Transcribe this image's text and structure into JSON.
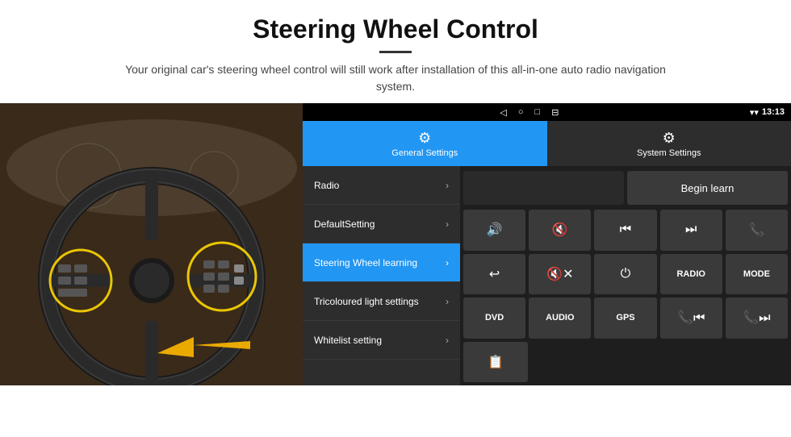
{
  "header": {
    "title": "Steering Wheel Control",
    "subtitle": "Your original car's steering wheel control will still work after installation of this all-in-one auto radio navigation system."
  },
  "statusBar": {
    "time": "13:13",
    "backIcon": "◁",
    "homeIcon": "○",
    "squareIcon": "□",
    "menuIcon": "⊟",
    "wifiIcon": "▾",
    "signalIcon": "▾"
  },
  "tabs": [
    {
      "id": "general",
      "label": "General Settings",
      "icon": "⚙",
      "active": true
    },
    {
      "id": "system",
      "label": "System Settings",
      "icon": "⚙",
      "active": false
    }
  ],
  "menu": [
    {
      "id": "radio",
      "label": "Radio",
      "active": false
    },
    {
      "id": "default",
      "label": "DefaultSetting",
      "active": false
    },
    {
      "id": "steering",
      "label": "Steering Wheel learning",
      "active": true
    },
    {
      "id": "tricoloured",
      "label": "Tricoloured light settings",
      "active": false
    },
    {
      "id": "whitelist",
      "label": "Whitelist setting",
      "active": false
    }
  ],
  "controls": {
    "beginLearn": "Begin learn",
    "rows": [
      [
        {
          "id": "vol-up",
          "text": "🔊+",
          "type": "icon"
        },
        {
          "id": "vol-down",
          "text": "🔇-",
          "type": "icon"
        },
        {
          "id": "prev",
          "text": "⏮",
          "type": "icon"
        },
        {
          "id": "next",
          "text": "⏭",
          "type": "icon"
        },
        {
          "id": "call",
          "text": "📞",
          "type": "icon"
        }
      ],
      [
        {
          "id": "hangup",
          "text": "↩",
          "type": "icon"
        },
        {
          "id": "mute",
          "text": "🔇×",
          "type": "icon"
        },
        {
          "id": "power",
          "text": "⏻",
          "type": "icon"
        },
        {
          "id": "radio-btn",
          "text": "RADIO",
          "type": "text"
        },
        {
          "id": "mode",
          "text": "MODE",
          "type": "text"
        }
      ],
      [
        {
          "id": "dvd",
          "text": "DVD",
          "type": "text"
        },
        {
          "id": "audio",
          "text": "AUDIO",
          "type": "text"
        },
        {
          "id": "gps",
          "text": "GPS",
          "type": "text"
        },
        {
          "id": "prev-call",
          "text": "📞⏮",
          "type": "icon"
        },
        {
          "id": "next-call",
          "text": "📞⏭",
          "type": "icon"
        }
      ],
      [
        {
          "id": "misc",
          "text": "📋",
          "type": "icon"
        }
      ]
    ]
  }
}
